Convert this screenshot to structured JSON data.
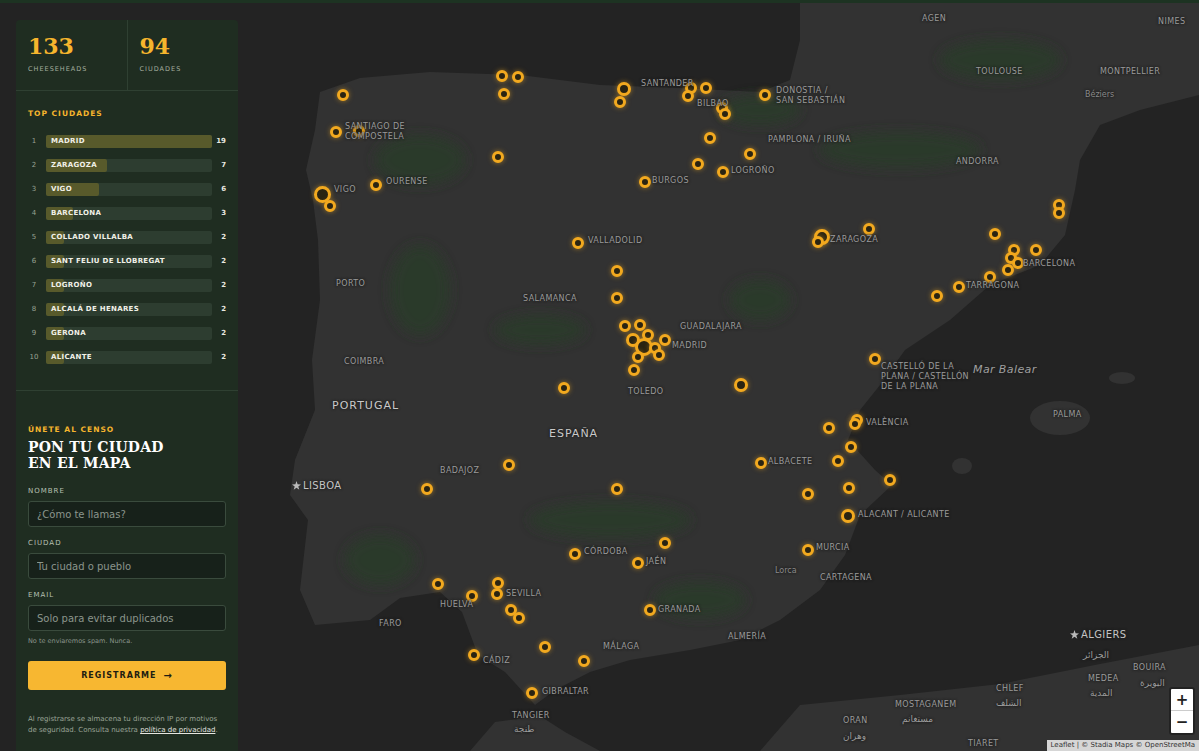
{
  "sidebar": {
    "stats": [
      {
        "value": "133",
        "label": "CHEESEHEADS"
      },
      {
        "value": "94",
        "label": "CIUDADES"
      }
    ],
    "top_cities": {
      "title": "TOP CIUDADES",
      "items": [
        {
          "rank": "1",
          "name": "MADRID",
          "count": "19",
          "level": 1.0
        },
        {
          "rank": "2",
          "name": "ZARAGOZA",
          "count": "7",
          "level": 0.37
        },
        {
          "rank": "3",
          "name": "VIGO",
          "count": "6",
          "level": 0.32
        },
        {
          "rank": "4",
          "name": "BARCELONA",
          "count": "3",
          "level": 0.16
        },
        {
          "rank": "5",
          "name": "COLLADO VILLALBA",
          "count": "2",
          "level": 0.11
        },
        {
          "rank": "6",
          "name": "SANT FELIU DE LLOBREGAT",
          "count": "2",
          "level": 0.11
        },
        {
          "rank": "7",
          "name": "LOGROÑO",
          "count": "2",
          "level": 0.11
        },
        {
          "rank": "8",
          "name": "ALCALÁ DE HENARES",
          "count": "2",
          "level": 0.11
        },
        {
          "rank": "9",
          "name": "GERONA",
          "count": "2",
          "level": 0.11
        },
        {
          "rank": "10",
          "name": "ALICANTE",
          "count": "2",
          "level": 0.11
        }
      ]
    },
    "signup": {
      "eyebrow": "ÚNETE AL CENSO",
      "title_lines": [
        "PON TU CIUDAD",
        "EN EL MAPA"
      ],
      "fields": [
        {
          "label": "NOMBRE",
          "placeholder": "¿Cómo te llamas?",
          "note": ""
        },
        {
          "label": "CIUDAD",
          "placeholder": "Tu ciudad o pueblo",
          "note": ""
        },
        {
          "label": "EMAIL",
          "placeholder": "Solo para evitar duplicados",
          "note": "No te enviaremos spam. Nunca."
        }
      ],
      "button": {
        "label": "REGISTRARME",
        "arrow": "→"
      },
      "legal": {
        "text": "Al registrarse se almacena tu dirección IP por motivos de seguridad. Consulta nuestra ",
        "link": "política de privacidad",
        "end": "."
      }
    }
  },
  "map": {
    "labels": [
      {
        "text": "AGEN",
        "kind": "city"
      },
      {
        "text": "TOULOUSE",
        "kind": "city"
      },
      {
        "text": "NIMES",
        "kind": "city"
      },
      {
        "text": "MONTPELLIER",
        "kind": "city"
      },
      {
        "text": "Béziers",
        "kind": "small"
      },
      {
        "text": "ANDORRA",
        "kind": "city"
      },
      {
        "text": "SANTANDER",
        "kind": "city"
      },
      {
        "text": "BILBAO",
        "kind": "city"
      },
      {
        "text": "DONOSTIA / SAN SEBASTIÁN",
        "kind": "city"
      },
      {
        "text": "PAMPLONA / IRUÑA",
        "kind": "city"
      },
      {
        "text": "SANTIAGO DE COMPOSTELA",
        "kind": "city"
      },
      {
        "text": "VIGO",
        "kind": "city"
      },
      {
        "text": "OURENSE",
        "kind": "city"
      },
      {
        "text": "BURGOS",
        "kind": "city"
      },
      {
        "text": "LOGROÑO",
        "kind": "city"
      },
      {
        "text": "ZARAGOZA",
        "kind": "city"
      },
      {
        "text": "VALLADOLID",
        "kind": "city"
      },
      {
        "text": "BARCELONA",
        "kind": "city"
      },
      {
        "text": "TARRAGONA",
        "kind": "city"
      },
      {
        "text": "PORTO",
        "kind": "city"
      },
      {
        "text": "SALAMANCA",
        "kind": "city"
      },
      {
        "text": "GUADALAJARA",
        "kind": "city"
      },
      {
        "text": "MADRID",
        "kind": "city"
      },
      {
        "text": "TOLEDO",
        "kind": "city"
      },
      {
        "text": "COIMBRA",
        "kind": "city"
      },
      {
        "text": "CASTELLÓ DE LA PLANA / CASTELLÓN DE LA PLANA",
        "kind": "city"
      },
      {
        "text": "Mar Balear",
        "kind": "sea"
      },
      {
        "text": "PORTUGAL",
        "kind": "country"
      },
      {
        "text": "ESPAÑA",
        "kind": "country"
      },
      {
        "text": "PALMA",
        "kind": "city"
      },
      {
        "text": "VALÈNCIA",
        "kind": "city"
      },
      {
        "text": "ALBACETE",
        "kind": "city"
      },
      {
        "text": "BADAJOZ",
        "kind": "city"
      },
      {
        "text": "LISBOA",
        "kind": "capital"
      },
      {
        "text": "ALACANT / ALICANTE",
        "kind": "city"
      },
      {
        "text": "CÓRDOBA",
        "kind": "city"
      },
      {
        "text": "JAÉN",
        "kind": "city"
      },
      {
        "text": "MURCIA",
        "kind": "city"
      },
      {
        "text": "Lorca",
        "kind": "small"
      },
      {
        "text": "CARTAGENA",
        "kind": "city"
      },
      {
        "text": "HUELVA",
        "kind": "city"
      },
      {
        "text": "SEVILLA",
        "kind": "city"
      },
      {
        "text": "GRANADA",
        "kind": "city"
      },
      {
        "text": "FARO",
        "kind": "city"
      },
      {
        "text": "MÁLAGA",
        "kind": "city"
      },
      {
        "text": "ALMERÍA",
        "kind": "city"
      },
      {
        "text": "CÁDIZ",
        "kind": "city"
      },
      {
        "text": "GIBRALTAR",
        "kind": "city"
      },
      {
        "text": "TANGIER",
        "kind": "city"
      },
      {
        "text": "طنجة",
        "kind": "arabic"
      },
      {
        "text": "ALGIERS",
        "kind": "capital"
      },
      {
        "text": "الجزائر",
        "kind": "arabic"
      },
      {
        "text": "ORAN",
        "kind": "city"
      },
      {
        "text": "وهران",
        "kind": "arabic"
      },
      {
        "text": "MOSTAGANEM",
        "kind": "city"
      },
      {
        "text": "مستغانم",
        "kind": "arabic"
      },
      {
        "text": "CHLEF",
        "kind": "city"
      },
      {
        "text": "الشلف",
        "kind": "arabic"
      },
      {
        "text": "MEDEA",
        "kind": "city"
      },
      {
        "text": "المدية",
        "kind": "arabic"
      },
      {
        "text": "BOUIRA",
        "kind": "city"
      },
      {
        "text": "البويرة",
        "kind": "arabic"
      },
      {
        "text": "TIARET",
        "kind": "city"
      }
    ],
    "zoom": {
      "in": "+",
      "out": "−"
    },
    "attribution": "Leaflet | © Stadia Maps © OpenStreetMa"
  }
}
